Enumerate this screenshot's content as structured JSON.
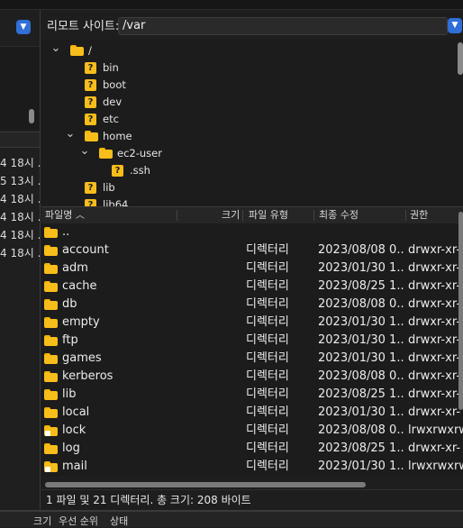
{
  "remote_site": {
    "label": "리모트 사이트:",
    "path": "/var"
  },
  "local_list": {
    "dates": [
      "4 18시 .",
      "5 13시 .",
      "4 18시 .",
      "4 18시 .",
      "4 18시 .",
      "4 18시 ."
    ]
  },
  "tree": {
    "items": [
      {
        "label": "/",
        "depth": 0,
        "expanded": true,
        "icon": "folder"
      },
      {
        "label": "bin",
        "depth": 1,
        "icon": "unknown-folder"
      },
      {
        "label": "boot",
        "depth": 1,
        "icon": "unknown-folder"
      },
      {
        "label": "dev",
        "depth": 1,
        "icon": "unknown-folder"
      },
      {
        "label": "etc",
        "depth": 1,
        "icon": "unknown-folder"
      },
      {
        "label": "home",
        "depth": 1,
        "expanded": true,
        "icon": "folder"
      },
      {
        "label": "ec2-user",
        "depth": 2,
        "expanded": true,
        "icon": "folder"
      },
      {
        "label": ".ssh",
        "depth": 3,
        "icon": "unknown-folder"
      },
      {
        "label": "lib",
        "depth": 1,
        "icon": "unknown-folder"
      },
      {
        "label": "lib64",
        "depth": 1,
        "icon": "unknown-folder"
      }
    ]
  },
  "columns": {
    "name": "파일명",
    "size": "크기",
    "type": "파일 유형",
    "modified": "최종 수정",
    "perm": "권한"
  },
  "files": [
    {
      "name": "..",
      "type": "",
      "modified": "",
      "perm": "",
      "link": false
    },
    {
      "name": "account",
      "type": "디렉터리",
      "modified": "2023/08/08 0...",
      "perm": "drwxr-xr-",
      "link": false
    },
    {
      "name": "adm",
      "type": "디렉터리",
      "modified": "2023/01/30 1...",
      "perm": "drwxr-xr-",
      "link": false
    },
    {
      "name": "cache",
      "type": "디렉터리",
      "modified": "2023/08/25 1...",
      "perm": "drwxr-xr-",
      "link": false
    },
    {
      "name": "db",
      "type": "디렉터리",
      "modified": "2023/08/08 0...",
      "perm": "drwxr-xr-",
      "link": false
    },
    {
      "name": "empty",
      "type": "디렉터리",
      "modified": "2023/01/30 1...",
      "perm": "drwxr-xr-",
      "link": false
    },
    {
      "name": "ftp",
      "type": "디렉터리",
      "modified": "2023/01/30 1...",
      "perm": "drwxr-xr-",
      "link": false
    },
    {
      "name": "games",
      "type": "디렉터리",
      "modified": "2023/01/30 1...",
      "perm": "drwxr-xr-",
      "link": false
    },
    {
      "name": "kerberos",
      "type": "디렉터리",
      "modified": "2023/08/08 0...",
      "perm": "drwxr-xr-",
      "link": false
    },
    {
      "name": "lib",
      "type": "디렉터리",
      "modified": "2023/08/25 1...",
      "perm": "drwxr-xr-",
      "link": false
    },
    {
      "name": "local",
      "type": "디렉터리",
      "modified": "2023/01/30 1...",
      "perm": "drwxr-xr-",
      "link": false
    },
    {
      "name": "lock",
      "type": "디렉터리",
      "modified": "2023/08/08 0...",
      "perm": "lrwxrwxrw",
      "link": true
    },
    {
      "name": "log",
      "type": "디렉터리",
      "modified": "2023/08/25 1...",
      "perm": "drwxr-xr-",
      "link": false
    },
    {
      "name": "mail",
      "type": "디렉터리",
      "modified": "2023/01/30 1...",
      "perm": "lrwxrwxrw",
      "link": true
    }
  ],
  "status": "1 파일 및 21 디렉터리. 총 크기: 208 바이트",
  "queue_columns": {
    "size": "크기",
    "priority": "우선 순위",
    "state": "상태"
  },
  "colors": {
    "accent": "#2f6fd6",
    "folder": "#f7bd1a",
    "background": "#1c1c1c"
  }
}
